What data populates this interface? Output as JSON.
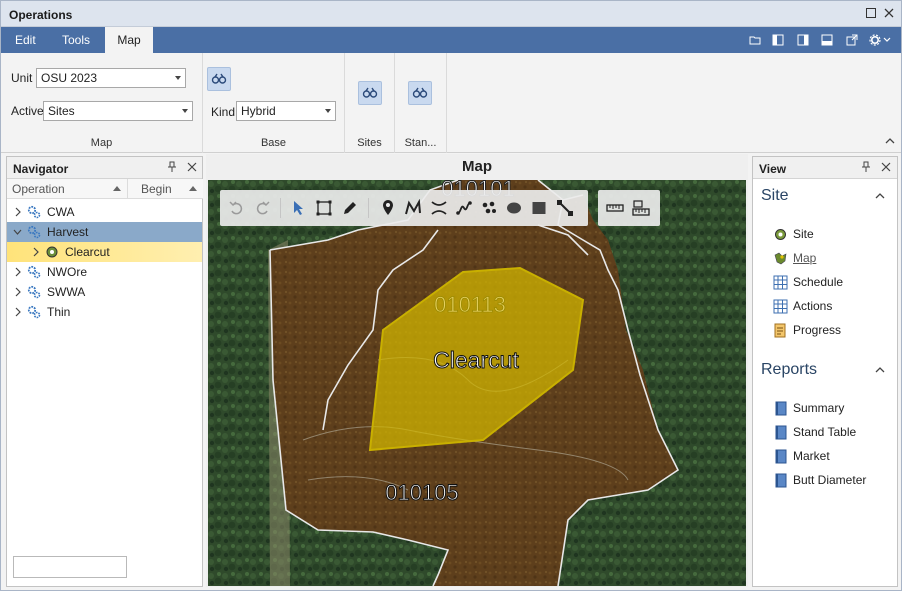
{
  "window": {
    "title": "Operations"
  },
  "tabs": [
    {
      "label": "Edit",
      "active": false
    },
    {
      "label": "Tools",
      "active": false
    },
    {
      "label": "Map",
      "active": true
    }
  ],
  "ribbon": {
    "map_group": {
      "label": "Map",
      "unit_label": "Unit",
      "unit_value": "OSU 2023",
      "active_label": "Active",
      "active_value": "Sites"
    },
    "base_group": {
      "label": "Base",
      "kind_label": "Kind",
      "kind_value": "Hybrid"
    },
    "sites_group": {
      "label": "Sites"
    },
    "stands_group": {
      "label": "Stan..."
    }
  },
  "navigator": {
    "title": "Navigator",
    "columns": [
      "Operation",
      "Begin"
    ],
    "rows": [
      {
        "label": "CWA",
        "level": 0,
        "state": "normal"
      },
      {
        "label": "Harvest",
        "level": 0,
        "state": "selected"
      },
      {
        "label": "Clearcut",
        "level": 1,
        "state": "highlight"
      },
      {
        "label": "NWOre",
        "level": 0,
        "state": "normal"
      },
      {
        "label": "SWWA",
        "level": 0,
        "state": "normal"
      },
      {
        "label": "Thin",
        "level": 0,
        "state": "normal"
      }
    ],
    "search_value": ""
  },
  "map": {
    "title": "Map",
    "labels": {
      "top": "010101",
      "stand_a": "010113",
      "site": "Clearcut",
      "stand_b": "010105"
    },
    "colors": {
      "site_fill": "#d4b800",
      "stand_fill": "#5e3f1c"
    }
  },
  "view": {
    "title": "View",
    "sections": [
      {
        "title": "Site",
        "items": [
          {
            "label": "Site",
            "icon": "site-icon"
          },
          {
            "label": "Map",
            "icon": "map-icon"
          },
          {
            "label": "Schedule",
            "icon": "grid-icon"
          },
          {
            "label": "Actions",
            "icon": "grid-icon"
          },
          {
            "label": "Progress",
            "icon": "progress-icon"
          }
        ]
      },
      {
        "title": "Reports",
        "items": [
          {
            "label": "Summary",
            "icon": "report-icon"
          },
          {
            "label": "Stand Table",
            "icon": "report-icon"
          },
          {
            "label": "Market",
            "icon": "report-icon"
          },
          {
            "label": "Butt Diameter",
            "icon": "report-icon"
          }
        ]
      }
    ]
  }
}
